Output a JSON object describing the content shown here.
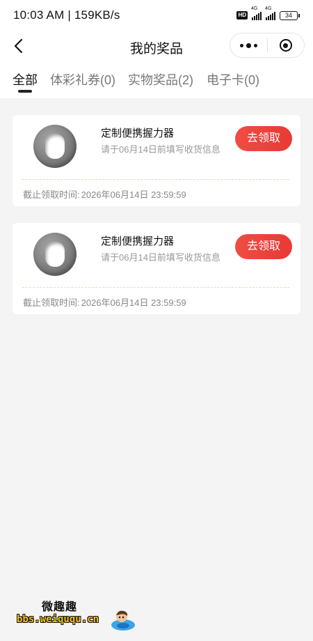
{
  "status_bar": {
    "time_speed": "10:03 AM | 159KB/s",
    "hd_badge": "HD",
    "signal1_tag": "4G",
    "signal2_tag": "4G",
    "battery": "34"
  },
  "nav": {
    "title": "我的奖品"
  },
  "tabs": [
    {
      "label": "全部",
      "active": true
    },
    {
      "label": "体彩礼券(0)",
      "active": false
    },
    {
      "label": "实物奖品(2)",
      "active": false
    },
    {
      "label": "电子卡(0)",
      "active": false
    }
  ],
  "prizes": [
    {
      "name": "定制便携握力器",
      "hint": "请于06月14日前填写收货信息",
      "button": "去领取",
      "deadline_label": "截止领取时间:",
      "deadline_value": "2026年06月14日 23:59:59"
    },
    {
      "name": "定制便携握力器",
      "hint": "请于06月14日前填写收货信息",
      "button": "去领取",
      "deadline_label": "截止领取时间:",
      "deadline_value": "2026年06月14日 23:59:59"
    }
  ],
  "watermark": {
    "title": "微趣趣",
    "url": "bbs.weiququ.cn"
  },
  "colors": {
    "accent_red": "#e8453c",
    "page_bg": "#f4f4f4",
    "divider_gold": "#e9dcb0"
  }
}
